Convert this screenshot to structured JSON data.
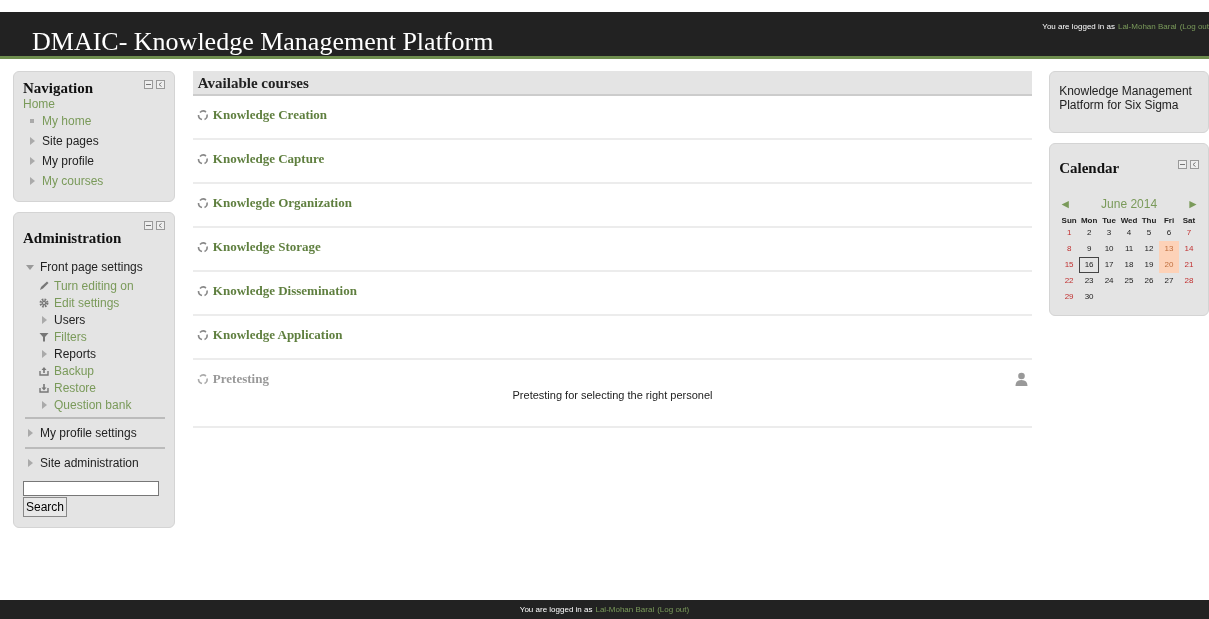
{
  "header": {
    "title": "DMAIC- Knowledge Management Platform",
    "login": {
      "prefix": "You are logged in as",
      "user": "Lal-Mohan Baral",
      "logout": "(Log out"
    }
  },
  "navigation": {
    "title": "Navigation",
    "home": "Home",
    "items": [
      {
        "label": "My home",
        "kind": "leaf",
        "link": true
      },
      {
        "label": "Site pages",
        "kind": "branch",
        "link": false
      },
      {
        "label": "My profile",
        "kind": "branch",
        "link": false
      },
      {
        "label": "My courses",
        "kind": "branch",
        "link": true
      }
    ]
  },
  "administration": {
    "title": "Administration",
    "items": [
      {
        "label": "Front page settings",
        "kind": "branch",
        "expanded": true,
        "link": false,
        "children": [
          {
            "label": "Turn editing on",
            "kind": "pencil",
            "link": true
          },
          {
            "label": "Edit settings",
            "kind": "gear",
            "link": true
          },
          {
            "label": "Users",
            "kind": "branch",
            "link": false
          },
          {
            "label": "Filters",
            "kind": "filter",
            "link": true
          },
          {
            "label": "Reports",
            "kind": "branch",
            "link": false
          },
          {
            "label": "Backup",
            "kind": "backup",
            "link": true
          },
          {
            "label": "Restore",
            "kind": "restore",
            "link": true
          },
          {
            "label": "Question bank",
            "kind": "branch",
            "link": true
          }
        ]
      },
      {
        "label": "My profile settings",
        "kind": "branch",
        "expanded": false,
        "link": false
      },
      {
        "label": "Site administration",
        "kind": "branch",
        "expanded": false,
        "link": false
      }
    ],
    "search_button": "Search"
  },
  "courses": {
    "title": "Available courses",
    "items": [
      {
        "name": "Knowledge Creation",
        "dimmed": false
      },
      {
        "name": "Knowledge Capture",
        "dimmed": false
      },
      {
        "name": "Knowlegde Organization",
        "dimmed": false
      },
      {
        "name": "Knowledge Storage",
        "dimmed": false
      },
      {
        "name": "Knowledge Dissemination",
        "dimmed": false
      },
      {
        "name": "Knowledge Application",
        "dimmed": false
      },
      {
        "name": "Pretesting",
        "dimmed": true,
        "summary": "Pretesting for selecting the right personel"
      }
    ]
  },
  "about": {
    "text": "Knowledge Management Platform for Six Sigma"
  },
  "calendar": {
    "title": "Calendar",
    "prev": "◄",
    "month": "June 2014",
    "next": "►",
    "weekdays": [
      "Sun",
      "Mon",
      "Tue",
      "Wed",
      "Thu",
      "Fri",
      "Sat"
    ],
    "days": [
      {
        "day": "1",
        "weekend": true,
        "event": false,
        "today": false
      },
      {
        "day": "2",
        "weekend": false,
        "event": false,
        "today": false
      },
      {
        "day": "3",
        "weekend": false,
        "event": false,
        "today": false
      },
      {
        "day": "4",
        "weekend": false,
        "event": false,
        "today": false
      },
      {
        "day": "5",
        "weekend": false,
        "event": false,
        "today": false
      },
      {
        "day": "6",
        "weekend": false,
        "event": false,
        "today": false
      },
      {
        "day": "7",
        "weekend": true,
        "event": false,
        "today": false
      },
      {
        "day": "8",
        "weekend": true,
        "event": false,
        "today": false
      },
      {
        "day": "9",
        "weekend": false,
        "event": false,
        "today": false
      },
      {
        "day": "10",
        "weekend": false,
        "event": false,
        "today": false
      },
      {
        "day": "11",
        "weekend": false,
        "event": false,
        "today": false
      },
      {
        "day": "12",
        "weekend": false,
        "event": false,
        "today": false
      },
      {
        "day": "13",
        "weekend": false,
        "event": true,
        "today": false
      },
      {
        "day": "14",
        "weekend": true,
        "event": false,
        "today": false
      },
      {
        "day": "15",
        "weekend": true,
        "event": false,
        "today": false
      },
      {
        "day": "16",
        "weekend": false,
        "event": false,
        "today": true
      },
      {
        "day": "17",
        "weekend": false,
        "event": false,
        "today": false
      },
      {
        "day": "18",
        "weekend": false,
        "event": false,
        "today": false
      },
      {
        "day": "19",
        "weekend": false,
        "event": false,
        "today": false
      },
      {
        "day": "20",
        "weekend": false,
        "event": true,
        "today": false
      },
      {
        "day": "21",
        "weekend": true,
        "event": false,
        "today": false
      },
      {
        "day": "22",
        "weekend": true,
        "event": false,
        "today": false
      },
      {
        "day": "23",
        "weekend": false,
        "event": false,
        "today": false
      },
      {
        "day": "24",
        "weekend": false,
        "event": false,
        "today": false
      },
      {
        "day": "25",
        "weekend": false,
        "event": false,
        "today": false
      },
      {
        "day": "26",
        "weekend": false,
        "event": false,
        "today": false
      },
      {
        "day": "27",
        "weekend": false,
        "event": false,
        "today": false
      },
      {
        "day": "28",
        "weekend": true,
        "event": false,
        "today": false
      },
      {
        "day": "29",
        "weekend": true,
        "event": false,
        "today": false
      },
      {
        "day": "30",
        "weekend": false,
        "event": false,
        "today": false
      }
    ]
  },
  "footer": {
    "prefix": "You are logged in as",
    "user": "Lal-Mohan Baral",
    "logout": "(Log out)"
  }
}
